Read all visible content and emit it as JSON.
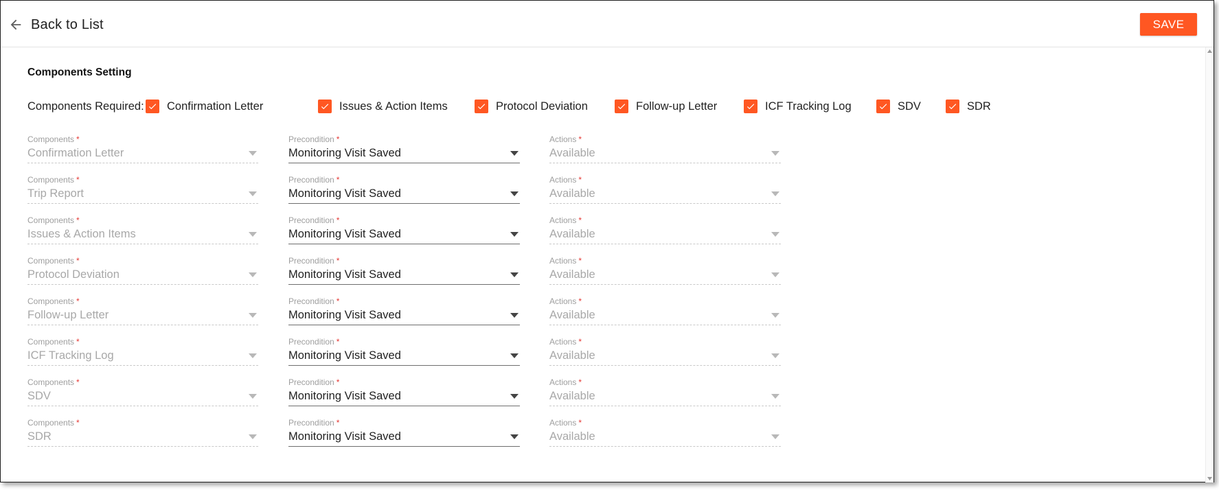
{
  "header": {
    "back_label": "Back to List",
    "save_label": "SAVE"
  },
  "colors": {
    "accent": "#ff5722",
    "required": "#e53935"
  },
  "section_title": "Components Setting",
  "components_required": {
    "label": "Components Required:",
    "items": [
      {
        "label": "Confirmation Letter",
        "checked": true
      },
      {
        "label": "Issues & Action Items",
        "checked": true
      },
      {
        "label": "Protocol Deviation",
        "checked": true
      },
      {
        "label": "Follow-up Letter",
        "checked": true
      },
      {
        "label": "ICF Tracking Log",
        "checked": true
      },
      {
        "label": "SDV",
        "checked": true
      },
      {
        "label": "SDR",
        "checked": true
      }
    ]
  },
  "field_labels": {
    "components": "Components",
    "precondition": "Precondition",
    "actions": "Actions",
    "required_marker": "*"
  },
  "rows": [
    {
      "component": "Confirmation Letter",
      "precondition": "Monitoring Visit Saved",
      "action": "Available"
    },
    {
      "component": "Trip Report",
      "precondition": "Monitoring Visit Saved",
      "action": "Available"
    },
    {
      "component": "Issues & Action Items",
      "precondition": "Monitoring Visit Saved",
      "action": "Available"
    },
    {
      "component": "Protocol Deviation",
      "precondition": "Monitoring Visit Saved",
      "action": "Available"
    },
    {
      "component": "Follow-up Letter",
      "precondition": "Monitoring Visit Saved",
      "action": "Available"
    },
    {
      "component": "ICF Tracking Log",
      "precondition": "Monitoring Visit Saved",
      "action": "Available"
    },
    {
      "component": "SDV",
      "precondition": "Monitoring Visit Saved",
      "action": "Available"
    },
    {
      "component": "SDR",
      "precondition": "Monitoring Visit Saved",
      "action": "Available"
    }
  ]
}
